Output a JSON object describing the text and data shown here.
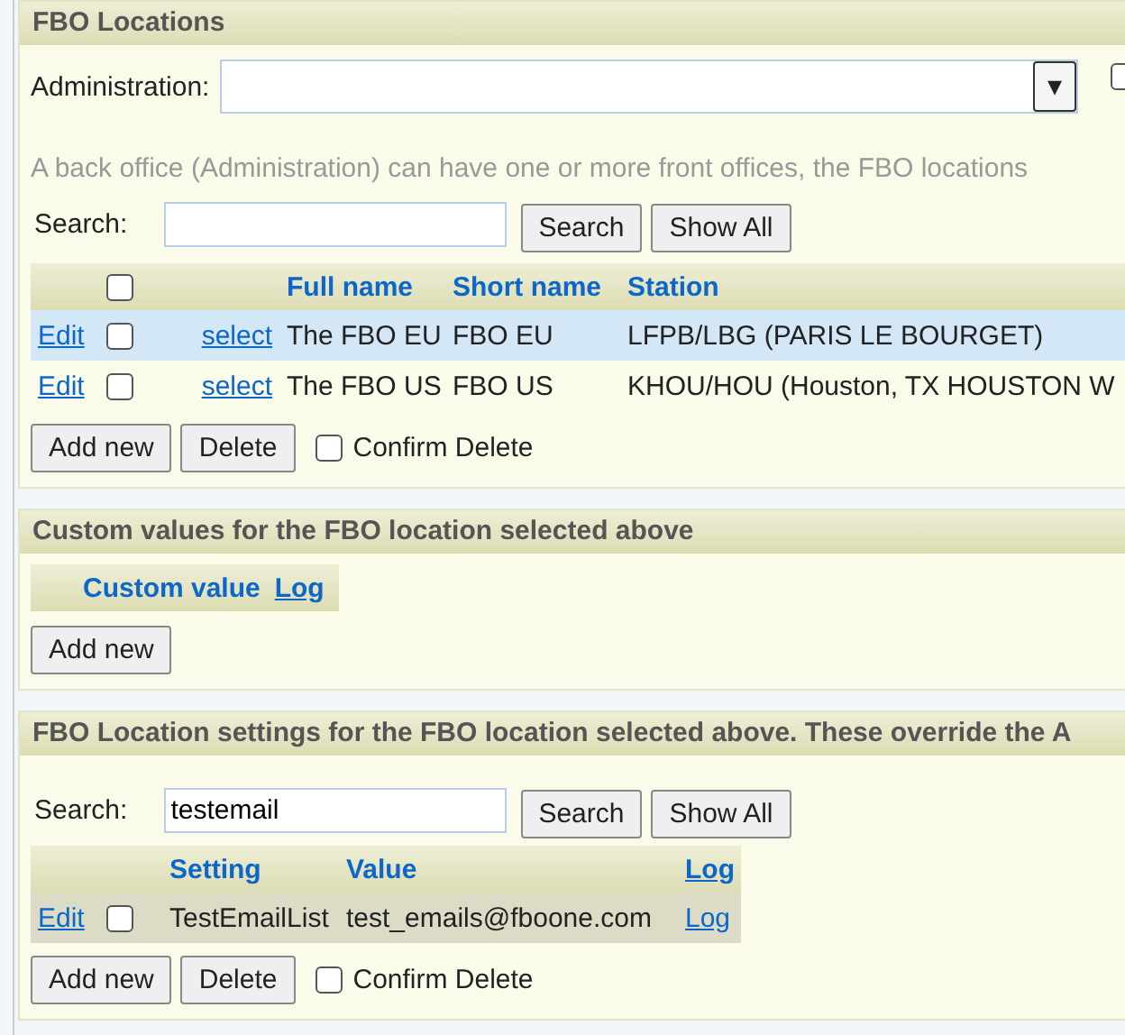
{
  "panels": [
    {
      "kind": "locations",
      "title": "FBO Locations",
      "administration": {
        "label": "Administration:",
        "dropdown": "▾"
      },
      "side_checkbox": {
        "checked": false
      },
      "hint": "A back office (Administration) can have one or more front offices, the FBO locations",
      "search": {
        "label": "Search:"
      },
      "search_buttons": [
        "Search",
        "Show All"
      ],
      "table": {
        "header_checkbox": {
          "checked": false
        },
        "columns": [
          "Full name",
          "Short name",
          "Station"
        ],
        "rows": [
          {
            "edit": "Edit",
            "checked": false,
            "select": "select",
            "full_name": "The FBO EU",
            "short_name": "FBO EU",
            "station": "LFPB/LBG (PARIS LE BOURGET)",
            "selected": true
          },
          {
            "edit": "Edit",
            "checked": false,
            "select": "select",
            "full_name": "The FBO US",
            "short_name": "FBO US",
            "station": "KHOU/HOU (Houston, TX HOUSTON W",
            "selected": false
          }
        ]
      },
      "buttons": [
        "Add new",
        "Delete"
      ],
      "confirm": {
        "label": "Confirm Delete",
        "checked": false
      }
    },
    {
      "kind": "custom",
      "title": "Custom values for the FBO location selected above",
      "columns": [
        "Custom value",
        "Log"
      ],
      "buttons": [
        "Add new"
      ]
    },
    {
      "kind": "settings",
      "title": "FBO Location settings for the FBO location selected above. These override the A",
      "search": {
        "label": "Search:",
        "value": "testemail"
      },
      "search_buttons": [
        "Search",
        "Show All"
      ],
      "table": {
        "columns": [
          "Setting",
          "Value",
          "Log"
        ],
        "rows": [
          {
            "edit": "Edit",
            "checked": false,
            "setting": "TestEmailList",
            "value": "test_emails@fboone.com",
            "log": "Log"
          }
        ]
      },
      "buttons": [
        "Add new",
        "Delete"
      ],
      "confirm": {
        "label": "Confirm Delete",
        "checked": false
      }
    }
  ]
}
